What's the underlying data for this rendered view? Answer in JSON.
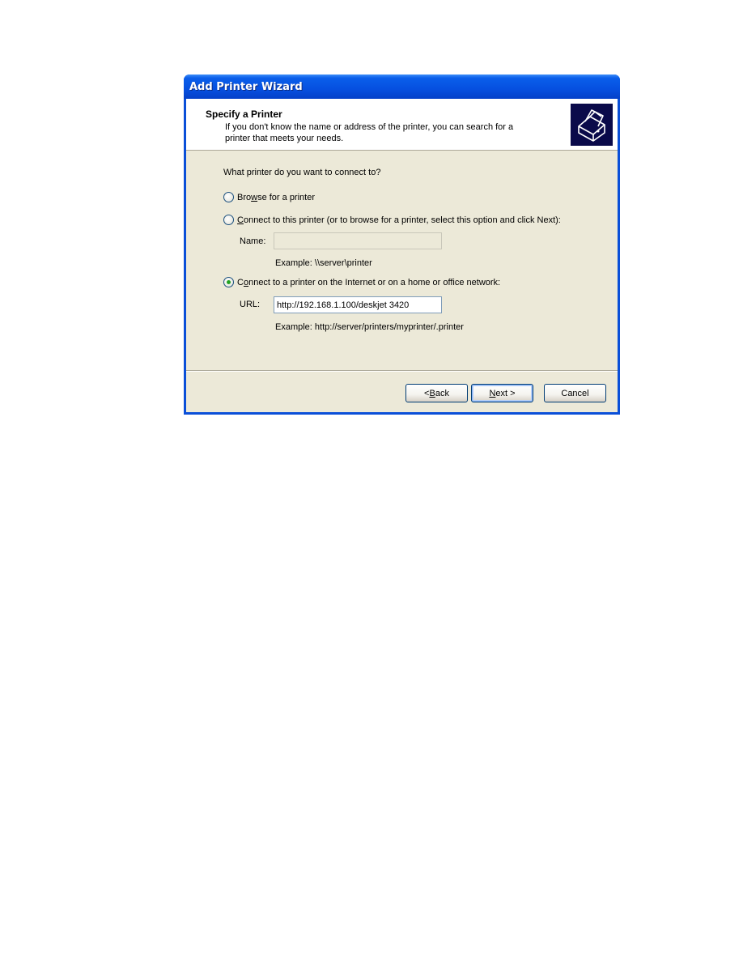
{
  "window": {
    "title": "Add Printer Wizard"
  },
  "header": {
    "title": "Specify a Printer",
    "description": "If you don't know the name or address of the printer, you can search for a printer that meets your needs.",
    "icon": "printer-icon"
  },
  "main": {
    "question": "What printer do you want to connect to?",
    "options": [
      {
        "label_pre": "Bro",
        "label_accel": "w",
        "label_post": "se for a printer",
        "checked": false
      },
      {
        "label_pre": "",
        "label_accel": "C",
        "label_post": "onnect to this printer (or to browse for a printer, select this option and click Next):",
        "checked": false
      },
      {
        "label_pre": "C",
        "label_accel": "o",
        "label_post": "nnect to a printer on the Internet or on a home or office network:",
        "checked": true
      }
    ],
    "name_field": {
      "label": "Name:",
      "value": "",
      "enabled": false,
      "example": "Example: \\\\server\\printer"
    },
    "url_field": {
      "label": "URL:",
      "value": "http://192.168.1.100/deskjet 3420",
      "enabled": true,
      "example": "Example: http://server/printers/myprinter/.printer"
    }
  },
  "buttons": {
    "back": {
      "pre": "< ",
      "accel": "B",
      "post": "ack"
    },
    "next": {
      "pre": "",
      "accel": "N",
      "post": "ext >"
    },
    "cancel": "Cancel"
  },
  "colors": {
    "titlebar": "#0650e0",
    "dialog_bg": "#ece9d8",
    "radio_dot": "#21a121"
  }
}
